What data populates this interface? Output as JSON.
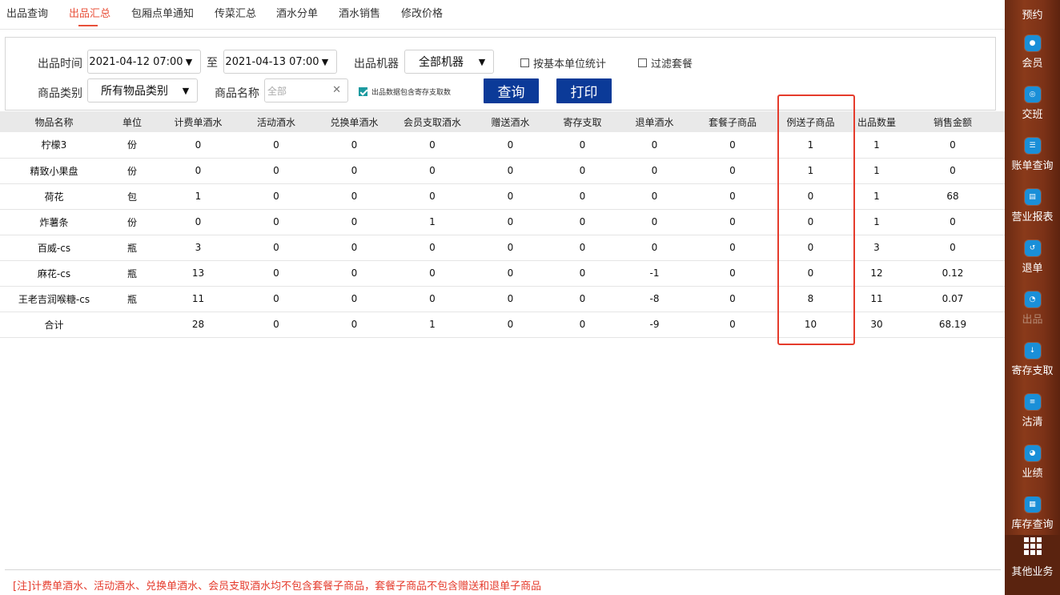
{
  "tabs": [
    {
      "label": "出品查询"
    },
    {
      "label": "出品汇总"
    },
    {
      "label": "包厢点单通知"
    },
    {
      "label": "传菜汇总"
    },
    {
      "label": "酒水分单"
    },
    {
      "label": "酒水销售"
    },
    {
      "label": "修改价格"
    }
  ],
  "active_tab": "出品汇总",
  "filters": {
    "time_label": "出品时间",
    "start_time": "2021-04-12 07:00",
    "to_label": "至",
    "end_time": "2021-04-13 07:00",
    "machine_label": "出品机器",
    "machine_value": "全部机器",
    "basic_unit_label": "按基本单位统计",
    "basic_unit_checked": false,
    "filter_set_label": "过滤套餐",
    "filter_set_checked": false,
    "category_label": "商品类别",
    "category_value": "所有物品类别",
    "name_label": "商品名称",
    "name_placeholder": "全部",
    "include_storage_label": "出品数据包含寄存支取数",
    "include_storage_checked": true,
    "query_button": "查询",
    "print_button": "打印"
  },
  "table": {
    "headers": [
      "物品名称",
      "单位",
      "计费单酒水",
      "活动酒水",
      "兑换单酒水",
      "会员支取酒水",
      "赠送酒水",
      "寄存支取",
      "退单酒水",
      "套餐子商品",
      "例送子商品",
      "出品数量",
      "销售金额"
    ],
    "rows": [
      [
        "柠檬3",
        "份",
        "0",
        "0",
        "0",
        "0",
        "0",
        "0",
        "0",
        "0",
        "1",
        "1",
        "0"
      ],
      [
        "精致小果盘",
        "份",
        "0",
        "0",
        "0",
        "0",
        "0",
        "0",
        "0",
        "0",
        "1",
        "1",
        "0"
      ],
      [
        "荷花",
        "包",
        "1",
        "0",
        "0",
        "0",
        "0",
        "0",
        "0",
        "0",
        "0",
        "1",
        "68"
      ],
      [
        "炸薯条",
        "份",
        "0",
        "0",
        "0",
        "1",
        "0",
        "0",
        "0",
        "0",
        "0",
        "1",
        "0"
      ],
      [
        "百威-cs",
        "瓶",
        "3",
        "0",
        "0",
        "0",
        "0",
        "0",
        "0",
        "0",
        "0",
        "3",
        "0"
      ],
      [
        "麻花-cs",
        "瓶",
        "13",
        "0",
        "0",
        "0",
        "0",
        "0",
        "-1",
        "0",
        "0",
        "12",
        "0.12"
      ],
      [
        "王老吉润喉糖-cs",
        "瓶",
        "11",
        "0",
        "0",
        "0",
        "0",
        "0",
        "-8",
        "0",
        "8",
        "11",
        "0.07"
      ],
      [
        "合计",
        "",
        "28",
        "0",
        "0",
        "1",
        "0",
        "0",
        "-9",
        "0",
        "10",
        "30",
        "68.19"
      ]
    ]
  },
  "note": "[注]计费单酒水、活动酒水、兑换单酒水、会员支取酒水均不包含套餐子商品，套餐子商品不包含赠送和退单子商品",
  "sidebar": {
    "items": [
      {
        "label": "预约",
        "icon": "calendar-icon"
      },
      {
        "label": "会员",
        "icon": "member-icon"
      },
      {
        "label": "交班",
        "icon": "shift-icon"
      },
      {
        "label": "账单查询",
        "icon": "bill-icon"
      },
      {
        "label": "营业报表",
        "icon": "report-icon"
      },
      {
        "label": "退单",
        "icon": "refund-icon"
      },
      {
        "label": "出品",
        "icon": "output-icon"
      },
      {
        "label": "寄存支取",
        "icon": "storage-icon"
      },
      {
        "label": "沽清",
        "icon": "soldout-icon"
      },
      {
        "label": "业绩",
        "icon": "performance-icon"
      },
      {
        "label": "库存查询",
        "icon": "inventory-icon"
      },
      {
        "label": "其他业务",
        "icon": "grid-icon"
      }
    ],
    "active": "出品"
  },
  "colors": {
    "accent_red": "#e8503a",
    "button_blue": "#0b3a98",
    "sidebar_brown": "#7c3217",
    "icon_blue": "#1a8fd8",
    "highlight_box": "#e53b2c"
  }
}
